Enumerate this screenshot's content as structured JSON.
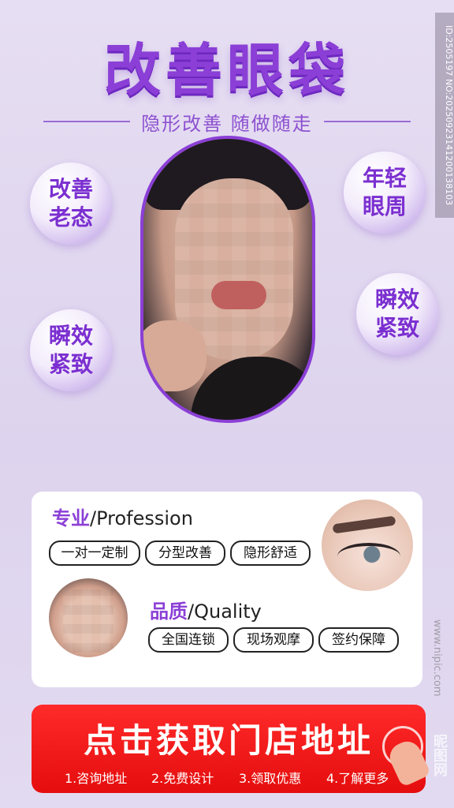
{
  "header": {
    "title": "改善眼袋",
    "subtitle": "隐形改善 随做随走"
  },
  "bubbles": {
    "top_left": [
      "改善",
      "老态"
    ],
    "bottom_left": [
      "瞬效",
      "紧致"
    ],
    "top_right": [
      "年轻",
      "眼周"
    ],
    "bottom_right": [
      "瞬效",
      "紧致"
    ]
  },
  "card": {
    "profession": {
      "accent": "专业",
      "label": "/Profession",
      "pills": [
        "一对一定制",
        "分型改善",
        "隐形舒适"
      ]
    },
    "quality": {
      "accent": "品质",
      "label": "/Quality",
      "pills": [
        "全国连锁",
        "现场观摩",
        "签约保障"
      ]
    }
  },
  "cta": {
    "label": "点击获取门店地址",
    "steps": [
      "1.咨询地址",
      "2.免费设计",
      "3.领取优惠",
      "4.了解更多"
    ]
  },
  "watermark": {
    "side_id": "ID:2505197 NO:20250923141200138103",
    "site": "www.nipic.com",
    "logo": "昵图网"
  },
  "colors": {
    "accent": "#8b3fd6",
    "cta": "#e50d0d",
    "background": "#e2daf0"
  }
}
